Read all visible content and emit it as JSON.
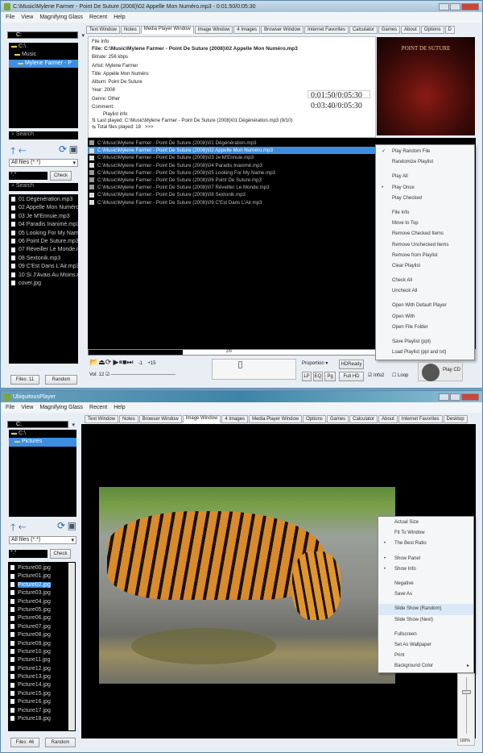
{
  "top": {
    "title": "C:\\Music\\Mylene Farmer - Point De Suture (2008)\\02 Appelle Mon Numéro.mp3 - 0:01:50/0:05:30",
    "menu": [
      "File",
      "View",
      "Magnifying Glass",
      "Recent",
      "Help"
    ],
    "tabs": [
      "Text Window",
      "Notes",
      "Media Player Window",
      "Image Window",
      "4 Images",
      "Browser Window",
      "Internet Favorites",
      "Calculator",
      "Games",
      "About",
      "Options",
      "D"
    ],
    "active_tab": "Media Player Window",
    "drive": "C:",
    "tree": [
      "C:\\",
      "Music",
      "Mylene Farmer - P"
    ],
    "search_placeholder": "Search",
    "filter": "All files (*.*)",
    "check_input": "*.*",
    "check_label": "Check",
    "files": [
      "01 Dégénération.mp3",
      "02 Appelle Mon Numéro.mp3",
      "03 Je M'Ennuie.mp3",
      "04 Paradis Inanimé.mp3",
      "05 Looking For My Name.mp3",
      "06 Point De Suture.mp3",
      "07 Réveiller Le Monde.mp3",
      "08 Sextonik.mp3",
      "09 C'Est Dans L'Air.mp3",
      "10 Si J'Avais Au Moins.mp3",
      "cover.jpg"
    ],
    "files_count": "Files: 11",
    "random_label": "Random",
    "file_info": {
      "header": "File Info",
      "file": "File:  C:\\Music\\Mylene Farmer - Point De Suture (2008)\\02 Appelle Mon Numéro.mp3",
      "bitrate": "Bitrate:  256 kbps",
      "artist": "Artist:  Mylene Farmer",
      "title": "Title:  Appelle Mon Numéro",
      "album": "Album:  Point De Suture",
      "year": "Year:  2008",
      "genre": "Genre:  Other",
      "comment": "Comment:",
      "time1": "0:01:50/0:05:30",
      "time2": "0:03:40/0:05:30",
      "playlist_header": "Playlist info",
      "last_played": "Last played: C:\\Music\\Mylene Farmer - Point De Suture (2008)\\01 Dégénération.mp3 (9/10)",
      "total_played": "Total files played: 18",
      "more": ">>>"
    },
    "album_art_text": "POINT DE SUTURE",
    "playlist": [
      {
        "path": "C:\\Music\\Mylene Farmer - Point De Suture (2008)\\01 Dégénération.mp3",
        "checked": true
      },
      {
        "path": "C:\\Music\\Mylene Farmer - Point De Suture (2008)\\02 Appelle Mon Numéro.mp3",
        "checked": false
      },
      {
        "path": "C:\\Music\\Mylene Farmer - Point De Suture (2008)\\03 Je M'Ennuie.mp3",
        "checked": false
      },
      {
        "path": "C:\\Music\\Mylene Farmer - Point De Suture (2008)\\04 Paradis Inanimé.mp3",
        "checked": false
      },
      {
        "path": "C:\\Music\\Mylene Farmer - Point De Suture (2008)\\05 Looking For My Name.mp3",
        "checked": true
      },
      {
        "path": "C:\\Music\\Mylene Farmer - Point De Suture (2008)\\06 Point De Suture.mp3",
        "checked": true
      },
      {
        "path": "C:\\Music\\Mylene Farmer - Point De Suture (2008)\\07 Réveiller Le Monde.mp3",
        "checked": true
      },
      {
        "path": "C:\\Music\\Mylene Farmer - Point De Suture (2008)\\08 Sextonik.mp3",
        "checked": false
      },
      {
        "path": "C:\\Music\\Mylene Farmer - Point De Suture (2008)\\09 C'Est Dans L'Air.mp3",
        "checked": false
      }
    ],
    "playlist_selected": 1,
    "context_menu": [
      {
        "label": "Play Random File",
        "mark": "✓"
      },
      {
        "label": "Randomize Playlist"
      },
      {
        "sep": true
      },
      {
        "label": "Play All"
      },
      {
        "label": "Play Once",
        "mark": "•"
      },
      {
        "label": "Play Checked"
      },
      {
        "sep": true
      },
      {
        "label": "File Info"
      },
      {
        "label": "Move to Top"
      },
      {
        "label": "Remove Checked Items"
      },
      {
        "label": "Remove Unchecked Items"
      },
      {
        "label": "Remove from Playlist"
      },
      {
        "label": "Clear Playlist"
      },
      {
        "sep": true
      },
      {
        "label": "Check All"
      },
      {
        "label": "Uncheck All"
      },
      {
        "sep": true
      },
      {
        "label": "Open With Default Player"
      },
      {
        "label": "Open With"
      },
      {
        "label": "Open File Folder"
      },
      {
        "sep": true
      },
      {
        "label": "Save Playlist (ppl)"
      },
      {
        "label": "Load Playlist (ppl and txt)"
      }
    ],
    "progress_label": "2/9",
    "progress_fraction": 0.33,
    "controls": {
      "minus1": "-1",
      "plus15": "+15",
      "vol": "Vol: 12",
      "proportion": "Proportion",
      "hdready": "HDReady",
      "lp": "LP",
      "eq": "EQ",
      "pg": "Pg",
      "fullhd": "Full HD",
      "info2": "Info2",
      "loop": "Loop",
      "playcd": "Play CD"
    }
  },
  "bottom": {
    "title": "UbiquitousPlayer",
    "menu": [
      "File",
      "View",
      "Magnifying Glass",
      "Recent",
      "Help"
    ],
    "tabs": [
      "Text Window",
      "Notes",
      "Browser Window",
      "Image Window",
      "4 Images",
      "Media Player Window",
      "Options",
      "Games",
      "Calculator",
      "About",
      "Internet Favorites",
      "Desktop"
    ],
    "active_tab": "Image Window",
    "drive": "C:",
    "tree": [
      "C:\\",
      "Pictures"
    ],
    "filter": "All files (*.*)",
    "check_input": "*.*",
    "check_label": "Check",
    "files": [
      "Picture00.jpg",
      "Picture01.jpg",
      "Picture02.jpg",
      "Picture03.jpg",
      "Picture04.jpg",
      "Picture05.jpg",
      "Picture06.jpg",
      "Picture07.jpg",
      "Picture08.jpg",
      "Picture09.jpg",
      "Picture10.jpg",
      "Picture11.jpg",
      "Picture12.jpg",
      "Picture13.jpg",
      "Picture14.jpg",
      "Picture15.jpg",
      "Picture16.jpg",
      "Picture17.jpg",
      "Picture18.jpg"
    ],
    "files_selected": 2,
    "files_count": "Files: 46",
    "random_label": "Random",
    "context_menu": [
      {
        "label": "Actual Size"
      },
      {
        "label": "Fit To Window"
      },
      {
        "label": "The Best Ratio",
        "mark": "•"
      },
      {
        "sep": true
      },
      {
        "label": "Show Panel",
        "mark": "•"
      },
      {
        "label": "Show Info",
        "mark": "•"
      },
      {
        "sep": true
      },
      {
        "label": "Negative"
      },
      {
        "label": "Save As"
      },
      {
        "sep": true
      },
      {
        "label": "Slide Show (Random)",
        "hl": true
      },
      {
        "label": "Slide Show (Next)"
      },
      {
        "sep": true
      },
      {
        "label": "Fullscreen"
      },
      {
        "label": "Set As Wallpaper"
      },
      {
        "label": "Print"
      },
      {
        "label": "Background Color",
        "sub": "▸"
      }
    ],
    "zoom": "100%"
  }
}
